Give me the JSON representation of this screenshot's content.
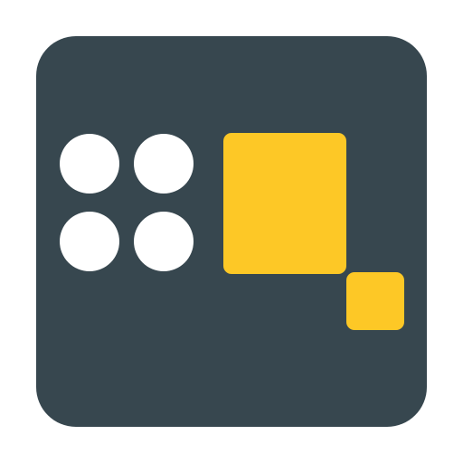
{
  "icon": {
    "name": "app-icon",
    "background_color": "#37474f",
    "dot_color": "#ffffff",
    "tile_color": "#fdc826",
    "dots": [
      {
        "name": "dot-top-left"
      },
      {
        "name": "dot-top-right"
      },
      {
        "name": "dot-bottom-left"
      },
      {
        "name": "dot-bottom-right"
      }
    ],
    "tiles": [
      {
        "name": "large-tile"
      },
      {
        "name": "small-tile"
      }
    ]
  }
}
